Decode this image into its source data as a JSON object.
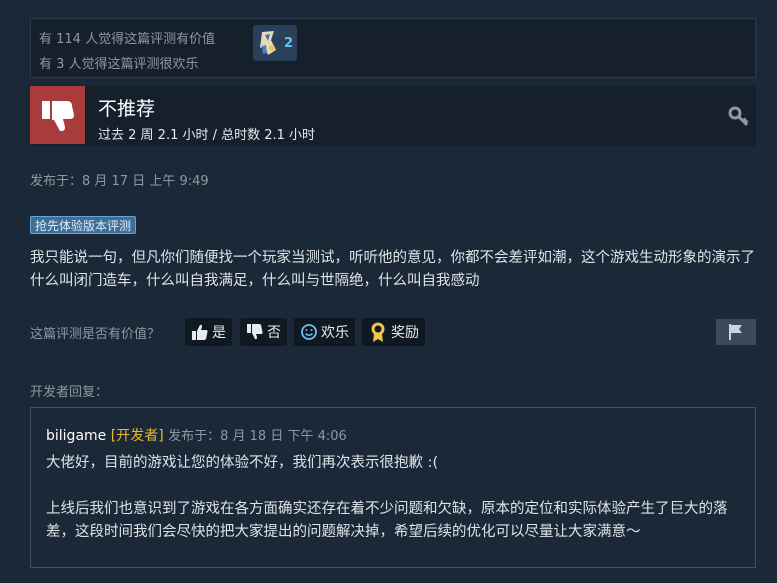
{
  "helpful": {
    "line1": "有 114 人觉得这篇评测有价值",
    "line2": "有 3 人觉得这篇评测很欢乐",
    "award_count": "2"
  },
  "review": {
    "recommendation": "不推荐",
    "hours": "过去 2 周 2.1 小时 / 总时数 2.1 小时",
    "posted": "发布于：8 月 17 日 上午 9:49",
    "badge": "抢先体验版本评测",
    "text": "我只能说一句，但凡你们随便找一个玩家当测试，听听他的意见，你都不会差评如潮，这个游戏生动形象的演示了什么叫闭门造车，什么叫自我满足，什么叫与世隔绝，什么叫自我感动"
  },
  "vote": {
    "question": "这篇评测是否有价值？",
    "yes": "是",
    "no": "否",
    "funny": "欢乐",
    "award": "奖励"
  },
  "developer": {
    "section_label": "开发者回复：",
    "name": "biligame",
    "tag": "[开发者]",
    "posted": "发布于：8 月 18 日 下午 4:06",
    "para1": "大佬好，目前的游戏让您的体验不好，我们再次表示很抱歉 :(",
    "para2": "上线后我们也意识到了游戏在各方面确实还存在着不少问题和欠缺，原本的定位和实际体验产生了巨大的落差，这段时间我们会尽快的把大家提出的问题解决掉，希望后续的优化可以尽量让大家满意～"
  },
  "colors": {
    "background": "#1b2838",
    "thumb_down": "#a83c3c",
    "developer_tag": "#e8b732",
    "award_count": "#66c0f4"
  },
  "icons": [
    "award-ribbon-icon",
    "thumbs-down-icon",
    "key-icon",
    "thumbs-up-icon",
    "smiley-icon",
    "award-medal-icon",
    "flag-icon"
  ]
}
